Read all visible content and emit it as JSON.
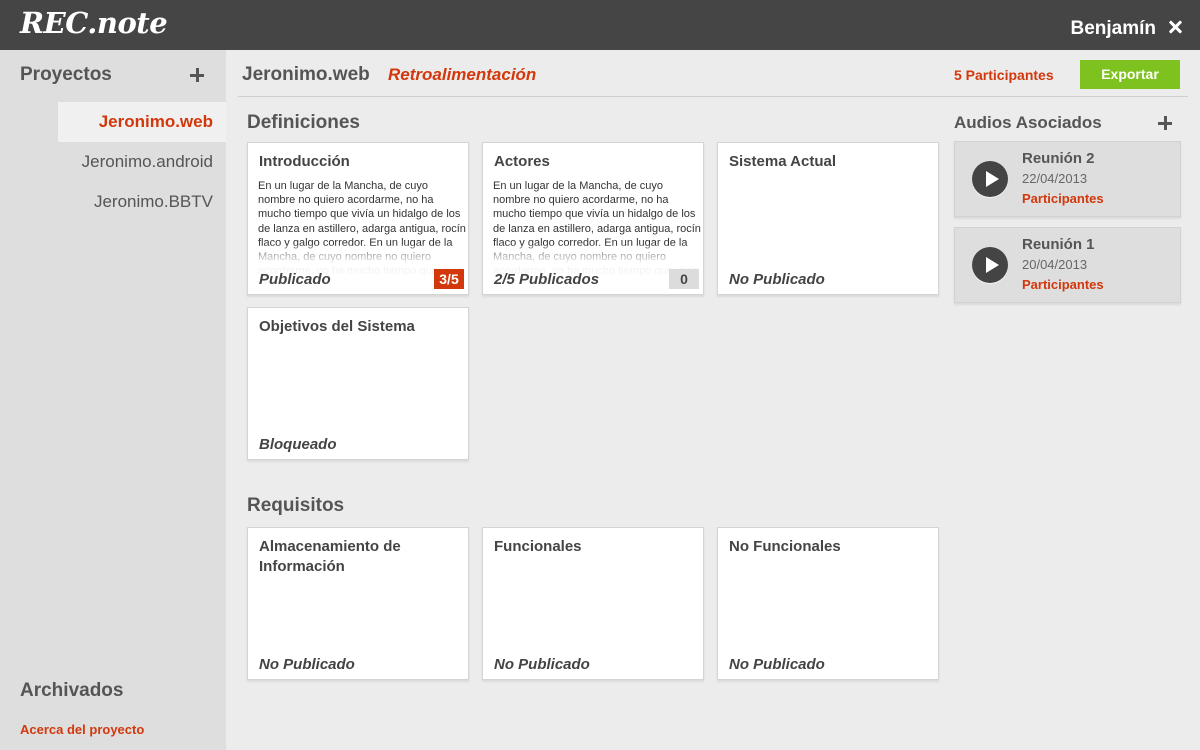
{
  "app": {
    "logo": "REC.note",
    "user": "Benjamín"
  },
  "sidebar": {
    "title": "Proyectos",
    "projects": [
      {
        "label": "Jeronimo.web",
        "active": true
      },
      {
        "label": "Jeronimo.android",
        "active": false
      },
      {
        "label": "Jeronimo.BBTV",
        "active": false
      }
    ],
    "archived": "Archivados",
    "about": "Acerca del proyecto"
  },
  "header": {
    "project": "Jeronimo.web",
    "mode": "Retroalimentación",
    "participants": "5 Participantes",
    "export_label": "Exportar"
  },
  "definiciones": {
    "title": "Definiciones",
    "cards": [
      {
        "title": "Introducción",
        "text": "En un lugar de la Mancha, de cuyo nombre no quiero acordarme, no ha mucho tiempo que vivía un hidalgo de los de lanza en astillero, adarga antigua, rocín flaco y galgo corredor. En un lugar de la Mancha, de cuyo nombre no quiero acordarme, no ha mucho tiempo que vivía un hidalgo",
        "status": "Publicado",
        "badge": "3/5"
      },
      {
        "title": "Actores",
        "text": "En un lugar de la Mancha, de cuyo nombre no quiero acordarme, no ha mucho tiempo que vivía un hidalgo de los de lanza en astillero, adarga antigua, rocín flaco y galgo corredor. En un lugar de la Mancha, de cuyo nombre no quiero acordarme, no ha mucho tiempo que vivía un hidalgo",
        "status": "2/5 Publicados",
        "badge": "0"
      },
      {
        "title": "Sistema Actual",
        "status": "No Publicado"
      },
      {
        "title": "Objetivos del Sistema",
        "status": "Bloqueado"
      }
    ]
  },
  "requisitos": {
    "title": "Requisitos",
    "cards": [
      {
        "title": "Almacenamiento de Información",
        "status": "No Publicado"
      },
      {
        "title": "Funcionales",
        "status": "No Publicado"
      },
      {
        "title": "No Funcionales",
        "status": "No Publicado"
      }
    ]
  },
  "audios": {
    "title": "Audios Asociados",
    "items": [
      {
        "name": "Reunión 2",
        "date": "22/04/2013",
        "participants": "Participantes"
      },
      {
        "name": "Reunión 1",
        "date": "20/04/2013",
        "participants": "Participantes"
      }
    ]
  },
  "colors": {
    "accent": "#d2380c",
    "export": "#7dc21e",
    "topbar": "#454545"
  },
  "icons": [
    "close-icon",
    "plus-icon",
    "play-icon"
  ]
}
